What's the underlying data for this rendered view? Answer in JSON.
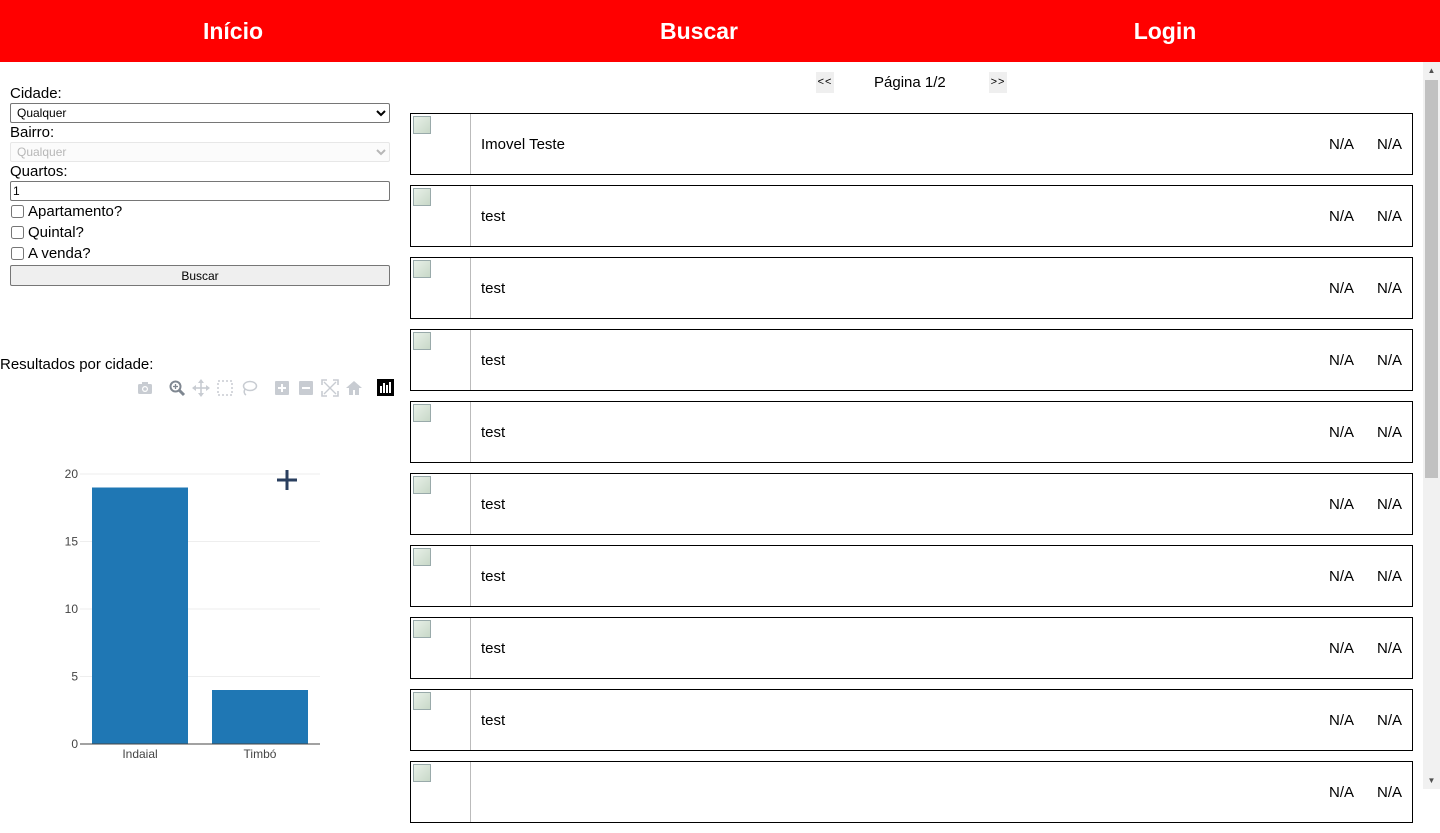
{
  "nav": {
    "home": "Início",
    "search": "Buscar",
    "login": "Login"
  },
  "filters": {
    "city_label": "Cidade:",
    "city_value": "Qualquer",
    "neighborhood_label": "Bairro:",
    "neighborhood_value": "Qualquer",
    "rooms_label": "Quartos:",
    "rooms_value": "1",
    "apartment_label": "Apartamento?",
    "yard_label": "Quintal?",
    "sale_label": "A venda?",
    "search_button": "Buscar"
  },
  "chart_section": {
    "title": "Resultados por cidade:",
    "modebar_icons": [
      "camera-icon",
      "zoom-icon",
      "pan-icon",
      "box-select-icon",
      "lasso-icon",
      "zoom-in-icon",
      "zoom-out-icon",
      "autoscale-icon",
      "home-icon",
      "plotly-logo-icon"
    ]
  },
  "chart_data": {
    "type": "bar",
    "categories": [
      "Indaial",
      "Timbó"
    ],
    "values": [
      19,
      4
    ],
    "title": "",
    "xlabel": "",
    "ylabel": "",
    "ylim": [
      0,
      20
    ],
    "yticks": [
      0,
      5,
      10,
      15,
      20
    ],
    "bar_color": "#1f77b4",
    "grid": true
  },
  "pager": {
    "prev": "<<",
    "text": "Página 1/2",
    "next": ">>"
  },
  "results": [
    {
      "title": "Imovel Teste",
      "v1": "N/A",
      "v2": "N/A"
    },
    {
      "title": "test",
      "v1": "N/A",
      "v2": "N/A"
    },
    {
      "title": "test",
      "v1": "N/A",
      "v2": "N/A"
    },
    {
      "title": "test",
      "v1": "N/A",
      "v2": "N/A"
    },
    {
      "title": "test",
      "v1": "N/A",
      "v2": "N/A"
    },
    {
      "title": "test",
      "v1": "N/A",
      "v2": "N/A"
    },
    {
      "title": "test",
      "v1": "N/A",
      "v2": "N/A"
    },
    {
      "title": "test",
      "v1": "N/A",
      "v2": "N/A"
    },
    {
      "title": "test",
      "v1": "N/A",
      "v2": "N/A"
    },
    {
      "title": "",
      "v1": "N/A",
      "v2": "N/A"
    }
  ],
  "colors": {
    "nav_bg": "#ff0000",
    "nav_text": "#ffffff",
    "bar": "#1f77b4"
  }
}
